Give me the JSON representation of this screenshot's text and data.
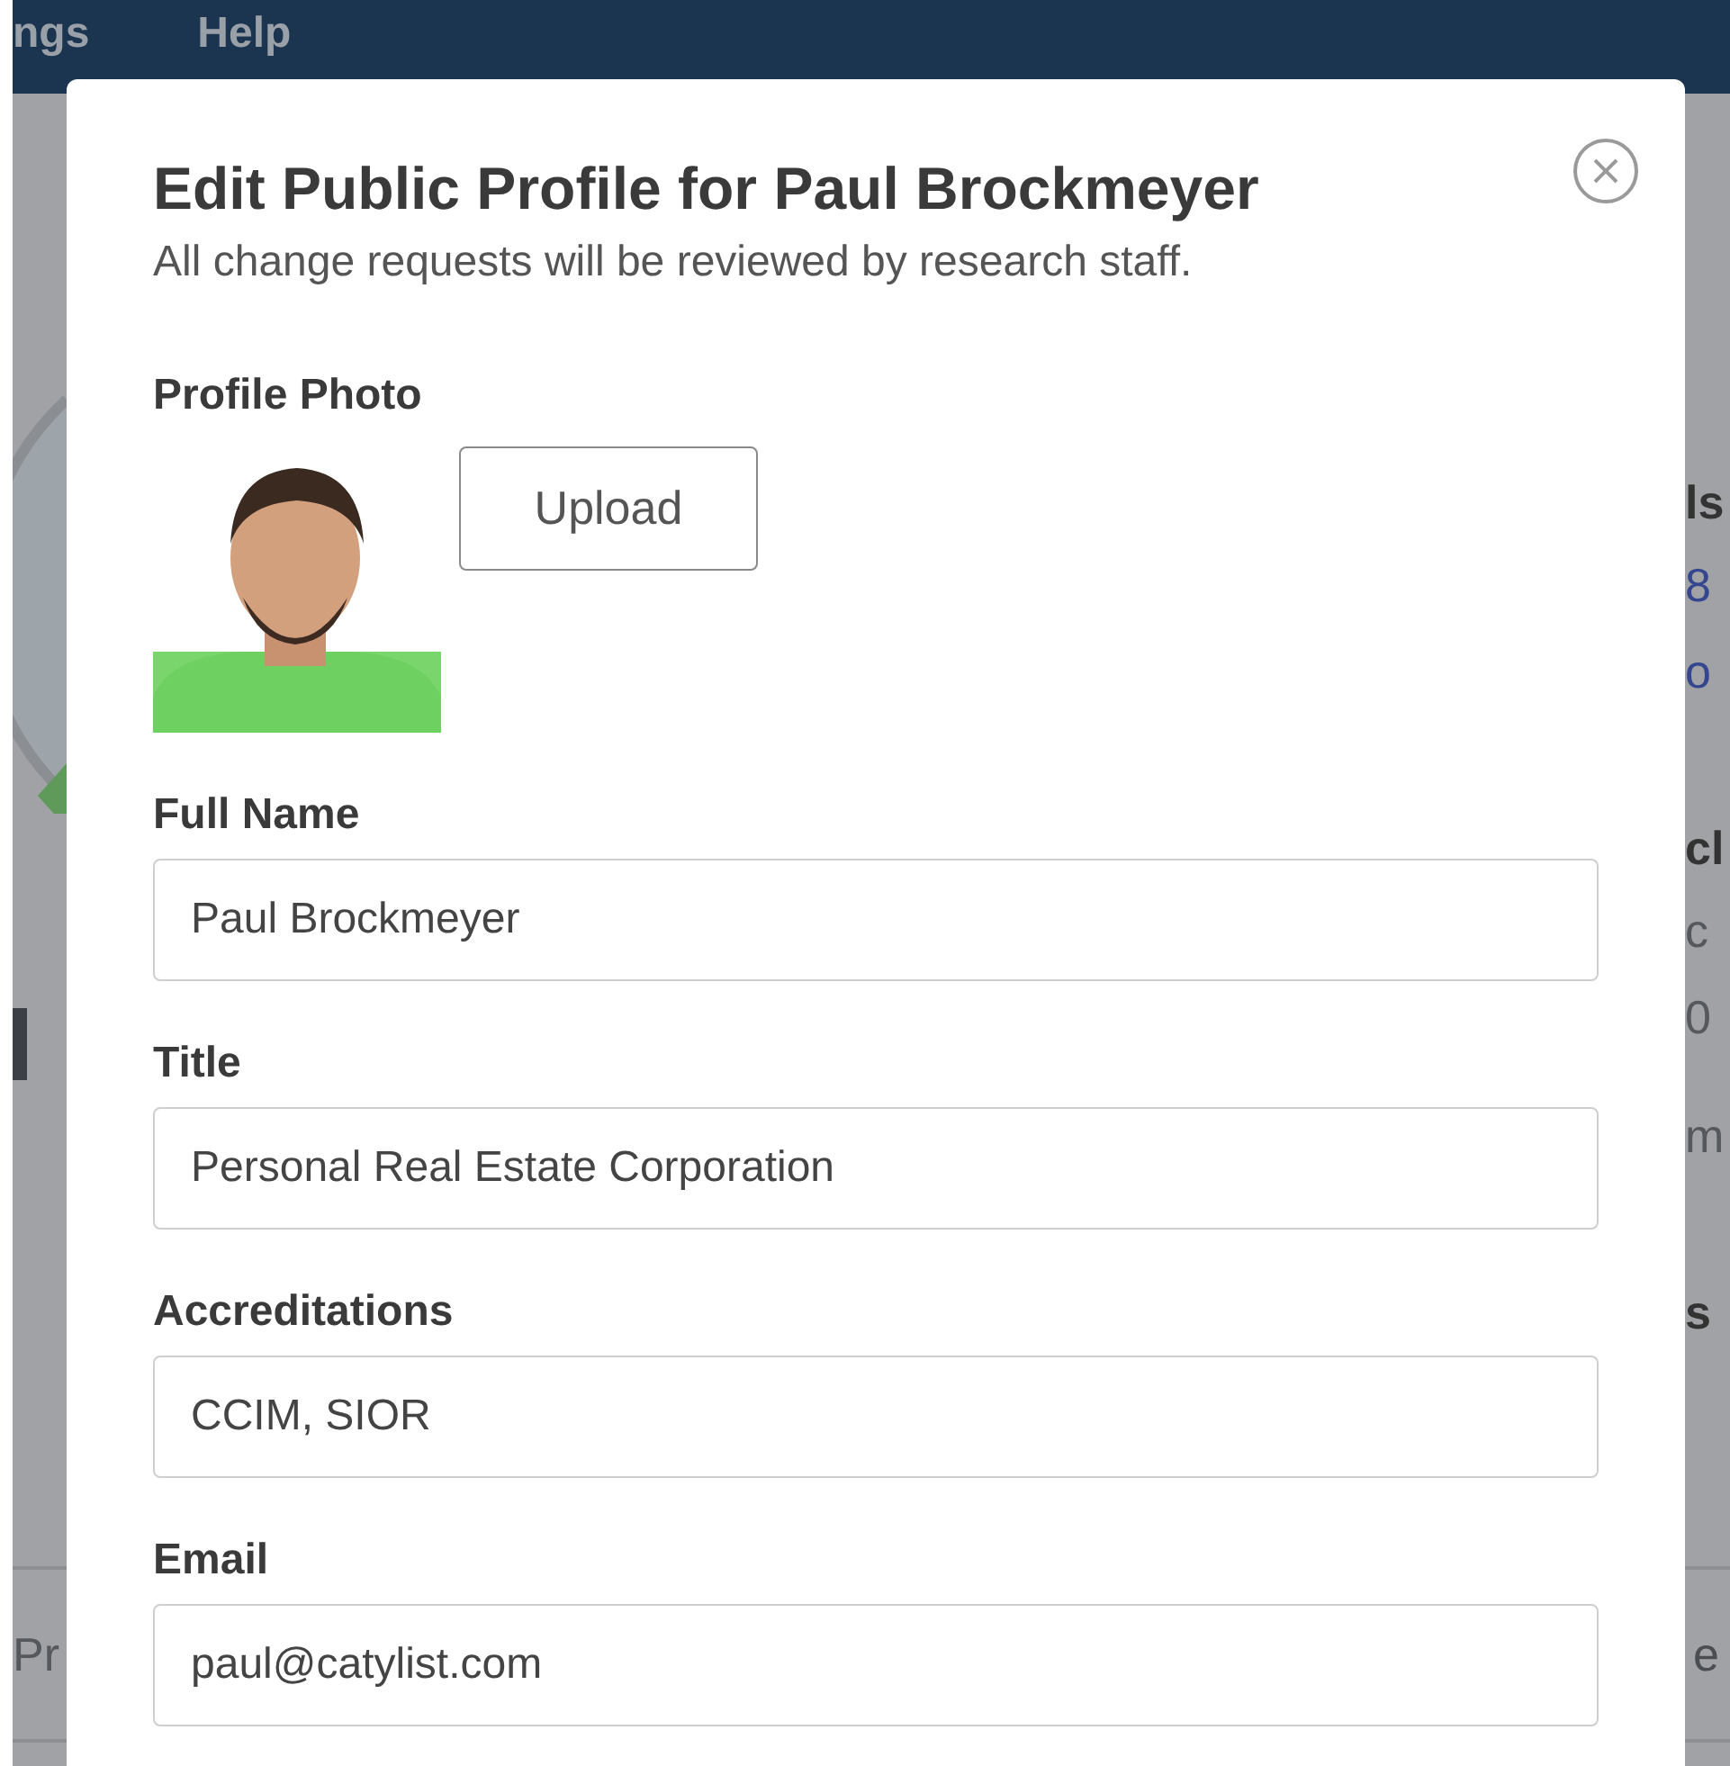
{
  "nav": {
    "items": [
      "ngs",
      "Help"
    ]
  },
  "background": {
    "right_fragments": [
      {
        "text": "ls",
        "kind": "heading"
      },
      {
        "text": "8",
        "kind": "link"
      },
      {
        "text": "o",
        "kind": "link"
      },
      {
        "text": "cl",
        "kind": "heading"
      },
      {
        "text": "c",
        "kind": "text"
      },
      {
        "text": "0",
        "kind": "text"
      },
      {
        "text": "m",
        "kind": "text"
      },
      {
        "text": "s",
        "kind": "heading"
      }
    ],
    "bottom_left_tab": "Pr",
    "bottom_right_tab": "e"
  },
  "modal": {
    "title": "Edit Public Profile for Paul Brockmeyer",
    "subtitle": "All change requests will be reviewed by research staff.",
    "photo_label": "Profile Photo",
    "upload_button": "Upload",
    "fields": [
      {
        "label": "Full Name",
        "value": "Paul Brockmeyer"
      },
      {
        "label": "Title",
        "value": "Personal Real Estate Corporation"
      },
      {
        "label": "Accreditations",
        "value": "CCIM, SIOR"
      },
      {
        "label": "Email",
        "value": "paul@catylist.com"
      }
    ]
  }
}
